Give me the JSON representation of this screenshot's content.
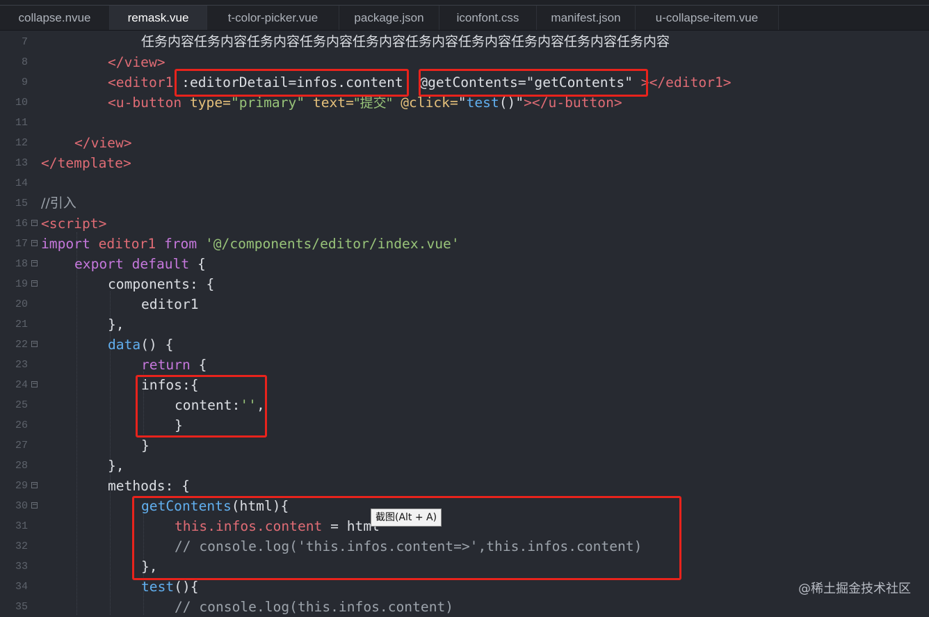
{
  "tabs": [
    {
      "label": "collapse.nvue"
    },
    {
      "label": "remask.vue"
    },
    {
      "label": "t-color-picker.vue"
    },
    {
      "label": "package.json"
    },
    {
      "label": "iconfont.css"
    },
    {
      "label": "manifest.json"
    },
    {
      "label": "u-collapse-item.vue"
    }
  ],
  "active_tab": "remask.vue",
  "lines": {
    "7": {
      "num": "7",
      "text": "任务内容任务内容任务内容任务内容任务内容任务内容任务内容任务内容任务内容任务内容"
    },
    "8": {
      "num": "8",
      "close_view": "</view>"
    },
    "9": {
      "num": "9",
      "open": "<editor1",
      "bind1": ":editorDetail=infos.content",
      "event": "@getContents=\"getContents\"",
      "close": "></editor1>"
    },
    "10": {
      "num": "10",
      "open": "<u-button",
      "attr_type": "type=",
      "val_type": "\"primary\"",
      "attr_text": "text=",
      "val_text": "\"提交\"",
      "attr_click": "@click=",
      "val_click_q1": "\"",
      "val_click_fn": "test",
      "val_click_rest": "()\"",
      "close": "></u-button>"
    },
    "11": {
      "num": "11"
    },
    "12": {
      "num": "12",
      "text": "</view>"
    },
    "13": {
      "num": "13",
      "text": "</template>"
    },
    "14": {
      "num": "14"
    },
    "15": {
      "num": "15",
      "text": "//引入"
    },
    "16": {
      "num": "16",
      "text": "<script>"
    },
    "17": {
      "num": "17",
      "kw_import": "import",
      "name": "editor1",
      "kw_from": "from",
      "path": "'@/components/editor/index.vue'"
    },
    "18": {
      "num": "18",
      "kw_export": "export",
      "kw_default": "default",
      "brace": "{"
    },
    "19": {
      "num": "19",
      "key": "components",
      "rest": ": {"
    },
    "20": {
      "num": "20",
      "text": "editor1"
    },
    "21": {
      "num": "21",
      "text": "},"
    },
    "22": {
      "num": "22",
      "fn": "data",
      "rest": "() {"
    },
    "23": {
      "num": "23",
      "kw": "return",
      "rest": " {"
    },
    "24": {
      "num": "24",
      "text": "infos:{"
    },
    "25": {
      "num": "25",
      "key": "content:",
      "str": "''",
      "rest": ","
    },
    "26": {
      "num": "26",
      "text": "}"
    },
    "27": {
      "num": "27",
      "text": "}"
    },
    "28": {
      "num": "28",
      "text": "},"
    },
    "29": {
      "num": "29",
      "key": "methods",
      "rest": ": {"
    },
    "30": {
      "num": "30",
      "fn": "getContents",
      "rest": "(html){"
    },
    "31": {
      "num": "31",
      "kw": "this",
      "prop": ".infos.content",
      "rest": " = html"
    },
    "32": {
      "num": "32",
      "text": "// console.log('this.infos.content=>',this.infos.content)"
    },
    "33": {
      "num": "33",
      "text": "},"
    },
    "34": {
      "num": "34",
      "fn": "test",
      "rest": "(){"
    },
    "35": {
      "num": "35",
      "text": "// console.log(this.infos.content)"
    }
  },
  "tooltip": "截图(Alt + A)",
  "watermark": "@稀土掘金技术社区",
  "colors": {
    "background": "#272a31",
    "tag": "#e06c75",
    "string": "#98c379",
    "keyword": "#c678dd",
    "function": "#61afef",
    "highlight_box": "#e8231c"
  }
}
